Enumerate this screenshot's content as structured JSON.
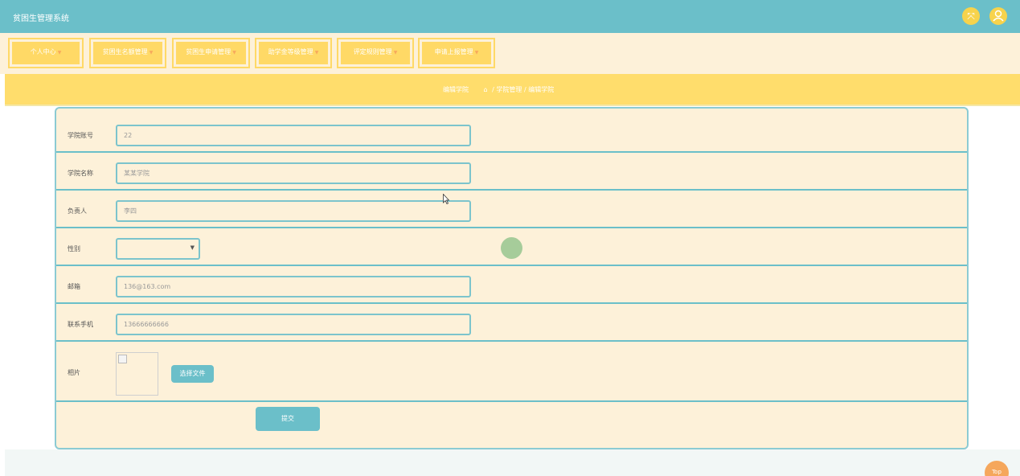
{
  "app": {
    "title": "贫困生管理系统"
  },
  "header_icons": [
    "switch-icon",
    "user-icon"
  ],
  "nav": {
    "items": [
      {
        "label": "个人中心"
      },
      {
        "label": "贫困生名额管理"
      },
      {
        "label": "贫困生申请管理"
      },
      {
        "label": "助学金等级管理"
      },
      {
        "label": "评定规则管理"
      },
      {
        "label": "申请上报管理"
      }
    ]
  },
  "breadcrumb": {
    "current": "编辑学院",
    "path": "/ 学院管理 / 编辑学院"
  },
  "form": {
    "college_id": {
      "label": "学院账号",
      "value": "22"
    },
    "college_name": {
      "label": "学院名称",
      "value": "某某学院"
    },
    "leader": {
      "label": "负责人",
      "value": "李四"
    },
    "gender": {
      "label": "性别",
      "value": ""
    },
    "email": {
      "label": "邮箱",
      "value": "136@163.com"
    },
    "phone": {
      "label": "联系手机",
      "value": "13666666666"
    },
    "photo": {
      "label": "相片",
      "button": "选择文件"
    },
    "submit": "提交"
  },
  "back_to_top": "Top",
  "colors": {
    "header": "#6bbfc9",
    "nav_bg": "#fdf1d9",
    "nav_item": "#ffd966",
    "breadcrumb_bg": "#ffdd6c",
    "form_bg": "#fdf1d9",
    "accent": "#6bbfc9",
    "top_button": "#f5a75c"
  }
}
